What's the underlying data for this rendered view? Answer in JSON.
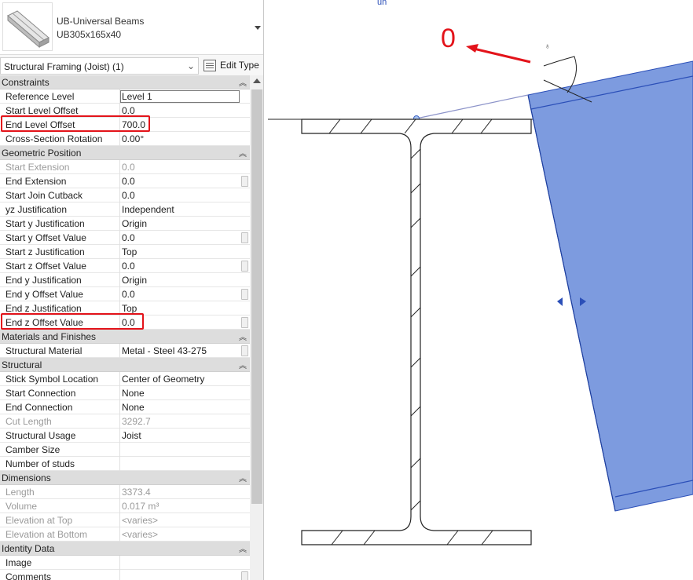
{
  "type_selector": {
    "family": "UB-Universal Beams",
    "type_name": "UB305x165x40"
  },
  "filter": {
    "selected": "Structural Framing (Joist) (1)",
    "edit_type_label": "Edit Type"
  },
  "categories": {
    "constraints": "Constraints",
    "geometric_position": "Geometric Position",
    "materials_finishes": "Materials and Finishes",
    "structural": "Structural",
    "dimensions": "Dimensions",
    "identity_data": "Identity Data"
  },
  "constraints": {
    "reference_level": {
      "name": "Reference Level",
      "value": "Level 1"
    },
    "start_level_offset": {
      "name": "Start Level Offset",
      "value": "0.0"
    },
    "end_level_offset": {
      "name": "End Level Offset",
      "value": "700.0"
    },
    "cross_section_rotation": {
      "name": "Cross-Section Rotation",
      "value": "0.00°"
    }
  },
  "geometric_position": {
    "start_extension": {
      "name": "Start Extension",
      "value": "0.0"
    },
    "end_extension": {
      "name": "End Extension",
      "value": "0.0"
    },
    "start_join_cutback": {
      "name": "Start Join Cutback",
      "value": "0.0"
    },
    "yz_justification": {
      "name": "yz Justification",
      "value": "Independent"
    },
    "start_y_justification": {
      "name": "Start y Justification",
      "value": "Origin"
    },
    "start_y_offset_value": {
      "name": "Start y Offset Value",
      "value": "0.0"
    },
    "start_z_justification": {
      "name": "Start z Justification",
      "value": "Top"
    },
    "start_z_offset_value": {
      "name": "Start z Offset Value",
      "value": "0.0"
    },
    "end_y_justification": {
      "name": "End y Justification",
      "value": "Origin"
    },
    "end_y_offset_value": {
      "name": "End y Offset Value",
      "value": "0.0"
    },
    "end_z_justification": {
      "name": "End z Justification",
      "value": "Top"
    },
    "end_z_offset_value": {
      "name": "End z Offset Value",
      "value": "0.0"
    }
  },
  "materials_finishes": {
    "structural_material": {
      "name": "Structural Material",
      "value": "Metal - Steel 43-275"
    }
  },
  "structural": {
    "stick_symbol_location": {
      "name": "Stick Symbol Location",
      "value": "Center of Geometry"
    },
    "start_connection": {
      "name": "Start Connection",
      "value": "None"
    },
    "end_connection": {
      "name": "End Connection",
      "value": "None"
    },
    "cut_length": {
      "name": "Cut Length",
      "value": "3292.7"
    },
    "structural_usage": {
      "name": "Structural Usage",
      "value": "Joist"
    },
    "camber_size": {
      "name": "Camber Size",
      "value": ""
    },
    "number_of_studs": {
      "name": "Number of studs",
      "value": ""
    }
  },
  "dimensions": {
    "length": {
      "name": "Length",
      "value": "3373.4"
    },
    "volume": {
      "name": "Volume",
      "value": "0.017 m³"
    },
    "elevation_at_top": {
      "name": "Elevation at Top",
      "value": "<varies>"
    },
    "elevation_at_bottom": {
      "name": "Elevation at Bottom",
      "value": "<varies>"
    }
  },
  "identity_data": {
    "image": {
      "name": "Image",
      "value": ""
    },
    "comments": {
      "name": "Comments",
      "value": ""
    }
  },
  "canvas": {
    "annotation_text": "0"
  },
  "colors": {
    "highlight_red": "#e3131a",
    "beam_fill": "#7d9bdf",
    "beam_edge": "#2b4fb8",
    "category_bg": "#dddddd"
  },
  "icons": {
    "type_thumbnail": "beam-thumbnail-icon",
    "edit_type": "edit-type-icon",
    "dropdown": "chevron-down-icon",
    "collapse": "collapse-chevrons-icon",
    "scroll_up": "scroll-up-icon"
  }
}
